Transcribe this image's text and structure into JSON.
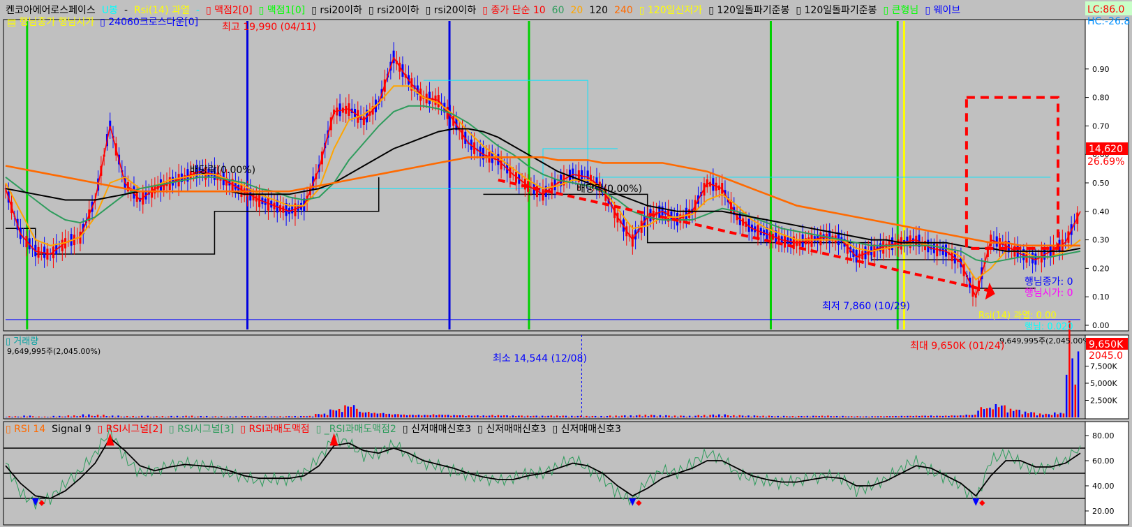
{
  "colors": {
    "background": "#c0c0c0",
    "axis_panel": "#ffffff",
    "up": "#ff0000",
    "down": "#0000ff",
    "ma10": "#ff0000",
    "ma60": "#2e9c5c",
    "ma20": "#ffa500",
    "ma120": "#000000",
    "ma240": "#ff6a00",
    "green_marker": "#00d000",
    "blue_marker": "#0000e0",
    "yellow_marker": "#ffff00",
    "cyan": "#00e5ff",
    "dashed_box": "#ff0000"
  },
  "header": {
    "items": [
      {
        "text": "켄코아에어로스페이스",
        "color": "#000000"
      },
      {
        "text": "U봉",
        "color": "#00ffff"
      },
      {
        "text": "-",
        "color": "#000000"
      },
      {
        "text": "Rsi(14) 과열",
        "color": "#ffff00"
      },
      {
        "text": "-",
        "color": "#00ffff"
      },
      {
        "text": "▯ 맥점2[0]",
        "color": "#ff0000"
      },
      {
        "text": "▯ 맥점1[0]",
        "color": "#00ff00"
      },
      {
        "text": "▯ rsi20이하",
        "color": "#000000"
      },
      {
        "text": "▯ rsi20이하",
        "color": "#000000"
      },
      {
        "text": "▯ rsi20이하",
        "color": "#000000"
      },
      {
        "text": "▯ 종가 단순 10",
        "color": "#ff0000"
      },
      {
        "text": "60",
        "color": "#2e9c5c"
      },
      {
        "text": "20",
        "color": "#ffa500"
      },
      {
        "text": "120",
        "color": "#000000"
      },
      {
        "text": "240",
        "color": "#ff6a00"
      },
      {
        "text": "▯ 120일신저가",
        "color": "#ffff00"
      },
      {
        "text": "▯ 120일돌파기준봉",
        "color": "#000000"
      },
      {
        "text": "▯ 120일돌파기준봉",
        "color": "#000000"
      },
      {
        "text": "▯ 큰형님",
        "color": "#00ff00"
      },
      {
        "text": "▯ 웨이브",
        "color": "#0000ff"
      }
    ],
    "line2": [
      {
        "text": "▤ 행님종가 행님시가",
        "color": "#ffff00"
      },
      {
        "text": "▯ 24060크로스다운[0]",
        "color": "#0000ff"
      }
    ],
    "lc_label": "LC:86.0",
    "hc_label": "HC:-26.8"
  },
  "price_panel": {
    "y_ticks": [
      "0.90",
      "0.80",
      "0.70",
      "0.60",
      "0.50",
      "0.40",
      "0.30",
      "0.20",
      "0.10",
      "0.00"
    ],
    "current_price": "14,620",
    "current_change": "26.69%",
    "high_label": "최고 19,990 (04/11)",
    "low_label": "최저 7,860 (10/29)",
    "dividend_label_1": "배당락(0.00%)",
    "dividend_label_2": "배당락(0.00%)",
    "side_label_close": "행님종가: 0",
    "side_label_open": "행님시가: 0",
    "side_label_rsi": "Rsi(14) 과열: 0.00",
    "side_label_bottom": "행님: 0.020"
  },
  "volume_panel": {
    "title": "▯ 거래량",
    "top_left_value": "9,649,995주(2,045.00%)",
    "top_right_value": "9,649,995주(2,045.00%)",
    "min_label": "최소 14,544 (12/08)",
    "max_label": "최대 9,650K (01/24)",
    "badge_value": "9,650K",
    "badge_pct": "2045.0",
    "y_ticks": [
      "7,500K",
      "5,000K",
      "2,500K"
    ]
  },
  "rsi_panel": {
    "legend": [
      {
        "text": "▯ RSI 14",
        "color": "#ff6a00"
      },
      {
        "text": "Signal 9",
        "color": "#000000"
      },
      {
        "text": "▯ RSI시그널[2]",
        "color": "#ff0000"
      },
      {
        "text": "▯ RSI시그널[3]",
        "color": "#2e9c5c"
      },
      {
        "text": "▯ RSI과매도맥점",
        "color": "#ff0000"
      },
      {
        "text": "▯ _RSI과매도맥점2",
        "color": "#2e9c5c"
      },
      {
        "text": "▯ 신저매매신호3",
        "color": "#000000"
      },
      {
        "text": "▯ 신저매매신호3",
        "color": "#000000"
      },
      {
        "text": "▯ 신저매매신호3",
        "color": "#000000"
      }
    ],
    "y_ticks": [
      "80.00",
      "60.00",
      "40.00",
      "20.00"
    ],
    "levels": [
      70,
      50,
      30
    ]
  },
  "chart_data": [
    {
      "type": "candlestick",
      "title": "켄코아에어로스페이스",
      "ylim": [
        0,
        1
      ],
      "y_ticks": [
        0.0,
        0.1,
        0.2,
        0.3,
        0.4,
        0.5,
        0.6,
        0.7,
        0.8,
        0.9
      ],
      "series": [
        {
          "name": "종가 단순 10",
          "values": [
            0.48,
            0.32,
            0.26,
            0.25,
            0.29,
            0.31,
            0.44,
            0.7,
            0.5,
            0.44,
            0.48,
            0.5,
            0.52,
            0.54,
            0.53,
            0.5,
            0.47,
            0.44,
            0.42,
            0.4,
            0.42,
            0.55,
            0.75,
            0.76,
            0.72,
            0.78,
            0.94,
            0.86,
            0.8,
            0.79,
            0.72,
            0.64,
            0.6,
            0.58,
            0.53,
            0.49,
            0.46,
            0.5,
            0.53,
            0.52,
            0.48,
            0.38,
            0.3,
            0.38,
            0.4,
            0.37,
            0.4,
            0.5,
            0.48,
            0.38,
            0.34,
            0.32,
            0.3,
            0.29,
            0.3,
            0.31,
            0.3,
            0.24,
            0.26,
            0.28,
            0.29,
            0.3,
            0.27,
            0.26,
            0.22,
            0.1,
            0.3,
            0.28,
            0.25,
            0.23,
            0.26,
            0.29,
            0.4
          ]
        },
        {
          "name": "20",
          "values": [
            0.5,
            0.4,
            0.3,
            0.28,
            0.29,
            0.31,
            0.38,
            0.5,
            0.52,
            0.48,
            0.49,
            0.51,
            0.52,
            0.53,
            0.53,
            0.51,
            0.49,
            0.46,
            0.44,
            0.42,
            0.42,
            0.48,
            0.62,
            0.72,
            0.74,
            0.78,
            0.84,
            0.84,
            0.8,
            0.78,
            0.74,
            0.68,
            0.63,
            0.59,
            0.55,
            0.51,
            0.48,
            0.49,
            0.51,
            0.51,
            0.48,
            0.41,
            0.34,
            0.35,
            0.38,
            0.38,
            0.39,
            0.44,
            0.46,
            0.42,
            0.37,
            0.34,
            0.32,
            0.3,
            0.3,
            0.3,
            0.3,
            0.27,
            0.26,
            0.27,
            0.28,
            0.29,
            0.28,
            0.27,
            0.24,
            0.16,
            0.2,
            0.26,
            0.26,
            0.24,
            0.24,
            0.26,
            0.3
          ]
        },
        {
          "name": "60",
          "values": [
            0.52,
            0.48,
            0.44,
            0.4,
            0.37,
            0.36,
            0.38,
            0.42,
            0.46,
            0.48,
            0.49,
            0.5,
            0.51,
            0.52,
            0.52,
            0.51,
            0.5,
            0.48,
            0.47,
            0.45,
            0.44,
            0.45,
            0.5,
            0.58,
            0.64,
            0.7,
            0.75,
            0.77,
            0.77,
            0.76,
            0.74,
            0.71,
            0.67,
            0.63,
            0.6,
            0.56,
            0.53,
            0.51,
            0.5,
            0.49,
            0.47,
            0.44,
            0.4,
            0.38,
            0.37,
            0.37,
            0.37,
            0.39,
            0.41,
            0.4,
            0.38,
            0.36,
            0.34,
            0.33,
            0.32,
            0.31,
            0.3,
            0.29,
            0.28,
            0.28,
            0.28,
            0.28,
            0.28,
            0.27,
            0.26,
            0.23,
            0.22,
            0.23,
            0.24,
            0.24,
            0.24,
            0.25,
            0.26
          ]
        },
        {
          "name": "120",
          "values": [
            0.48,
            0.47,
            0.46,
            0.45,
            0.44,
            0.44,
            0.44,
            0.45,
            0.46,
            0.47,
            0.47,
            0.47,
            0.47,
            0.47,
            0.47,
            0.47,
            0.46,
            0.46,
            0.46,
            0.46,
            0.47,
            0.48,
            0.5,
            0.53,
            0.56,
            0.59,
            0.62,
            0.64,
            0.66,
            0.68,
            0.69,
            0.69,
            0.68,
            0.66,
            0.63,
            0.6,
            0.57,
            0.54,
            0.52,
            0.5,
            0.48,
            0.46,
            0.44,
            0.42,
            0.41,
            0.4,
            0.4,
            0.4,
            0.4,
            0.39,
            0.38,
            0.37,
            0.36,
            0.35,
            0.34,
            0.33,
            0.32,
            0.31,
            0.3,
            0.3,
            0.29,
            0.29,
            0.29,
            0.29,
            0.28,
            0.27,
            0.27,
            0.26,
            0.26,
            0.26,
            0.26,
            0.26,
            0.27
          ]
        },
        {
          "name": "240",
          "values": [
            0.56,
            0.55,
            0.54,
            0.53,
            0.52,
            0.51,
            0.5,
            0.49,
            0.48,
            0.47,
            0.47,
            0.47,
            0.47,
            0.47,
            0.47,
            0.47,
            0.47,
            0.47,
            0.47,
            0.47,
            0.48,
            0.49,
            0.5,
            0.51,
            0.52,
            0.53,
            0.54,
            0.55,
            0.56,
            0.57,
            0.58,
            0.59,
            0.59,
            0.59,
            0.59,
            0.59,
            0.59,
            0.58,
            0.58,
            0.58,
            0.57,
            0.57,
            0.57,
            0.57,
            0.57,
            0.56,
            0.55,
            0.54,
            0.52,
            0.5,
            0.48,
            0.46,
            0.44,
            0.42,
            0.41,
            0.4,
            0.39,
            0.38,
            0.37,
            0.36,
            0.35,
            0.34,
            0.33,
            0.32,
            0.31,
            0.3,
            0.29,
            0.29,
            0.28,
            0.28,
            0.28,
            0.28,
            0.28
          ]
        }
      ]
    },
    {
      "type": "bar",
      "title": "거래량",
      "ylim": [
        0,
        10000
      ],
      "y_ticks": [
        2500,
        5000,
        7500
      ],
      "values": [
        120,
        180,
        90,
        150,
        200,
        300,
        260,
        180,
        140,
        160,
        130,
        150,
        170,
        140,
        120,
        110,
        150,
        130,
        120,
        140,
        160,
        400,
        900,
        1350,
        620,
        500,
        380,
        300,
        280,
        320,
        260,
        220,
        210,
        240,
        200,
        180,
        170,
        190,
        160,
        150,
        140,
        180,
        200,
        260,
        220,
        180,
        160,
        240,
        300,
        220,
        190,
        170,
        150,
        140,
        160,
        180,
        150,
        130,
        120,
        140,
        160,
        180,
        200,
        190,
        220,
        300,
        1100,
        1400,
        900,
        600,
        400,
        500,
        9650
      ]
    },
    {
      "type": "line",
      "title": "RSI 14",
      "ylim": [
        10,
        90
      ],
      "y_ticks": [
        20,
        40,
        60,
        80
      ],
      "series": [
        {
          "name": "RSI 14",
          "values": [
            58,
            34,
            26,
            30,
            42,
            52,
            66,
            84,
            62,
            50,
            52,
            56,
            58,
            56,
            55,
            50,
            47,
            44,
            46,
            45,
            50,
            62,
            78,
            74,
            64,
            66,
            74,
            64,
            58,
            56,
            52,
            48,
            46,
            44,
            46,
            50,
            50,
            56,
            62,
            54,
            46,
            34,
            28,
            44,
            52,
            50,
            58,
            66,
            62,
            50,
            46,
            44,
            42,
            44,
            46,
            48,
            46,
            36,
            40,
            46,
            54,
            60,
            52,
            46,
            40,
            28,
            60,
            66,
            58,
            52,
            56,
            60,
            72
          ]
        },
        {
          "name": "Signal 9",
          "values": [
            56,
            42,
            32,
            30,
            36,
            46,
            58,
            78,
            68,
            56,
            52,
            55,
            57,
            56,
            55,
            52,
            48,
            46,
            46,
            46,
            48,
            56,
            72,
            74,
            68,
            66,
            70,
            66,
            60,
            57,
            54,
            50,
            47,
            45,
            45,
            48,
            50,
            54,
            58,
            56,
            50,
            40,
            32,
            38,
            46,
            50,
            54,
            60,
            60,
            54,
            48,
            45,
            43,
            43,
            45,
            47,
            46,
            40,
            40,
            44,
            50,
            56,
            54,
            48,
            42,
            32,
            48,
            60,
            60,
            55,
            55,
            58,
            66
          ]
        }
      ]
    }
  ]
}
